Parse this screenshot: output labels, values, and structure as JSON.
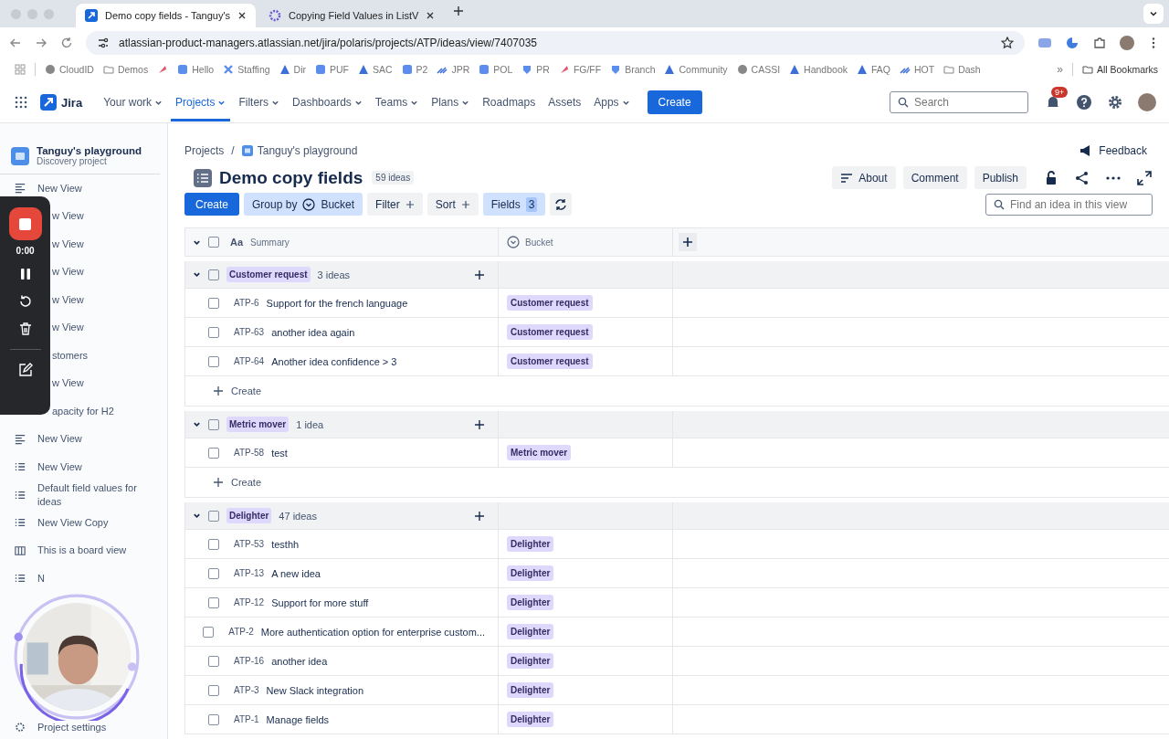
{
  "browser": {
    "tabs": [
      {
        "title": "Demo copy fields - Tanguy's",
        "selected": true
      },
      {
        "title": "Copying Field Values in ListV",
        "selected": false
      }
    ],
    "url": "atlassian-product-managers.atlassian.net/jira/polaris/projects/ATP/ideas/view/7407035",
    "bookmarks": [
      {
        "kind": "globe",
        "label": "CloudID"
      },
      {
        "kind": "folder",
        "label": "Demos"
      },
      {
        "kind": "mark"
      },
      {
        "kind": "app",
        "label": "Hello"
      },
      {
        "kind": "cross",
        "label": "Staffing"
      },
      {
        "kind": "triangle",
        "label": "Dir"
      },
      {
        "kind": "app",
        "label": "PUF"
      },
      {
        "kind": "triangle",
        "label": "SAC"
      },
      {
        "kind": "app",
        "label": "P2"
      },
      {
        "kind": "arrows",
        "label": "JPR"
      },
      {
        "kind": "app",
        "label": "POL"
      },
      {
        "kind": "shield",
        "label": "PR"
      },
      {
        "kind": "mark",
        "label": "FG/FF"
      },
      {
        "kind": "shield",
        "label": "Branch"
      },
      {
        "kind": "triangle",
        "label": "Community"
      },
      {
        "kind": "globe",
        "label": "CASSI"
      },
      {
        "kind": "triangle",
        "label": "Handbook"
      },
      {
        "kind": "triangle",
        "label": "FAQ"
      },
      {
        "kind": "arrows",
        "label": "HOT"
      },
      {
        "kind": "folder",
        "label": "Dash"
      }
    ],
    "more": "»",
    "all_bookmarks": "All Bookmarks"
  },
  "nav": {
    "product": "Jira",
    "items": [
      {
        "label": "Your work",
        "dropdown": true,
        "selected": false
      },
      {
        "label": "Projects",
        "dropdown": true,
        "selected": true
      },
      {
        "label": "Filters",
        "dropdown": true,
        "selected": false
      },
      {
        "label": "Dashboards",
        "dropdown": true,
        "selected": false
      },
      {
        "label": "Teams",
        "dropdown": true,
        "selected": false
      },
      {
        "label": "Plans",
        "dropdown": true,
        "selected": false
      },
      {
        "label": "Roadmaps",
        "dropdown": false,
        "selected": false
      },
      {
        "label": "Assets",
        "dropdown": false,
        "selected": false
      },
      {
        "label": "Apps",
        "dropdown": true,
        "selected": false
      }
    ],
    "create": "Create",
    "search": {
      "placeholder": "Search"
    },
    "notifications": "9+"
  },
  "sidebar": {
    "project": "Tanguy's playground",
    "type": "Discovery project",
    "items": [
      {
        "kind": "lines",
        "label": "New View"
      },
      {
        "kind": "clipped",
        "label": "w View"
      },
      {
        "kind": "clipped",
        "label": "w View"
      },
      {
        "kind": "clipped",
        "label": "w View"
      },
      {
        "kind": "clipped",
        "label": "w View"
      },
      {
        "kind": "clipped",
        "label": "w View"
      },
      {
        "kind": "clipped",
        "label": "stomers"
      },
      {
        "kind": "clipped",
        "label": "w View"
      },
      {
        "kind": "clipped",
        "label": "apacity for H2"
      },
      {
        "kind": "lines",
        "label": "New View"
      },
      {
        "kind": "list",
        "label": "New View"
      },
      {
        "kind": "list",
        "label": "Default field values for ideas"
      },
      {
        "kind": "list",
        "label": "New View Copy"
      },
      {
        "kind": "board",
        "label": "This is a board view"
      },
      {
        "kind": "list",
        "label": "N"
      }
    ],
    "footer": "Project settings"
  },
  "recorder": {
    "time": "0:00"
  },
  "page": {
    "breadcrumbs": [
      "Projects",
      "Tanguy's playground"
    ],
    "breadcrumb_separator": "/",
    "feedback": "Feedback",
    "title": "Demo copy fields",
    "count": "59 ideas",
    "actions": [
      "About",
      "Comment",
      "Publish"
    ],
    "toolbar": {
      "create": "Create",
      "group_by": "Group by",
      "group_field": "Bucket",
      "filter": "Filter",
      "sort": "Sort",
      "fields": "Fields",
      "fields_count": "3"
    },
    "search": {
      "placeholder": "Find an idea in this view"
    }
  },
  "table": {
    "header_checked": false,
    "columns": [
      {
        "kind": "text",
        "glyph": "Aa",
        "label": "Summary"
      },
      {
        "kind": "select",
        "label": "Bucket"
      }
    ],
    "groups": [
      {
        "name": "Customer request",
        "count": "3 ideas",
        "expanded": true,
        "checked": false,
        "create": "Create",
        "rows": [
          {
            "key": "ATP-6",
            "summary": "Support for the french language",
            "bucket": "Customer request",
            "checked": false
          },
          {
            "key": "ATP-63",
            "summary": "another idea again",
            "bucket": "Customer request",
            "checked": false
          },
          {
            "key": "ATP-64",
            "summary": "Another idea confidence > 3",
            "bucket": "Customer request",
            "checked": false
          }
        ]
      },
      {
        "name": "Metric mover",
        "count": "1 idea",
        "expanded": true,
        "checked": false,
        "create": "Create",
        "rows": [
          {
            "key": "ATP-58",
            "summary": "test",
            "bucket": "Metric mover",
            "checked": false
          }
        ]
      },
      {
        "name": "Delighter",
        "count": "47 ideas",
        "expanded": true,
        "checked": false,
        "rows": [
          {
            "key": "ATP-53",
            "summary": "testhh",
            "bucket": "Delighter",
            "checked": false
          },
          {
            "key": "ATP-13",
            "summary": "A new idea",
            "bucket": "Delighter",
            "checked": false
          },
          {
            "key": "ATP-12",
            "summary": "Support for more stuff",
            "bucket": "Delighter",
            "checked": false
          },
          {
            "key": "ATP-2",
            "summary": "More authentication option for enterprise custom...",
            "bucket": "Delighter",
            "checked": false
          },
          {
            "key": "ATP-16",
            "summary": "another idea",
            "bucket": "Delighter",
            "checked": false
          },
          {
            "key": "ATP-3",
            "summary": "New Slack integration",
            "bucket": "Delighter",
            "checked": false
          },
          {
            "key": "ATP-1",
            "summary": "Manage fields",
            "bucket": "Delighter",
            "checked": false
          }
        ]
      }
    ]
  }
}
